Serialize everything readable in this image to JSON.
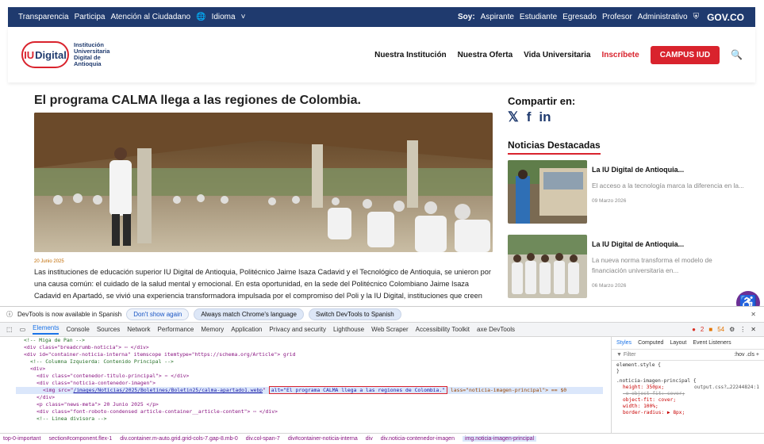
{
  "govbar": {
    "links": [
      "Transparencia",
      "Participa",
      "Atención al Ciudadano"
    ],
    "language": "Idioma",
    "soy_label": "Soy:",
    "roles": [
      "Aspirante",
      "Estudiante",
      "Egresado",
      "Profesor",
      "Administrativo"
    ],
    "gov_logo": "GOV.CO"
  },
  "header": {
    "logo_mark_iu": "IU",
    "logo_mark_rest": "Digital",
    "logo_lines": [
      "Institución",
      "Universitaria",
      "Digital de",
      "Antioquia"
    ],
    "nav": [
      "Nuestra Institución",
      "Nuestra Oferta",
      "Vida Universitaria"
    ],
    "inscribete": "Inscríbete",
    "campus": "CAMPUS IUD"
  },
  "article": {
    "title": "El programa CALMA llega a las regiones de Colombia.",
    "date": "20 Junio 2025",
    "body": "Las instituciones de educación superior IU Digital de Antioquia, Politécnico Jaime Isaza Cadavid y el Tecnológico de Antioquia, se unieron por una causa común: el cuidado de la salud mental y emocional. En esta oportunidad, en la sede del Politécnico Colombiano Jaime Isaza Cadavid en Apartadó, se vivió una experiencia transformadora impulsada por el compromiso del Poli y la IU Digital, instituciones que creen que la educación va"
  },
  "sidebar": {
    "share_title": "Compartir en:",
    "featured_title": "Noticias Destacadas",
    "news": [
      {
        "title": "La IU Digital de Antioquia...",
        "desc": "El acceso a la tecnología marca la diferencia en la...",
        "date": "09 Marzo 2026"
      },
      {
        "title": "La IU Digital de Antioquia...",
        "desc": "La nueva norma transforma el modelo de financiación universitaria en...",
        "date": "06 Marzo 2026"
      }
    ]
  },
  "devtools": {
    "notice": "DevTools is now available in Spanish",
    "btn_dont": "Don't show again",
    "btn_match": "Always match Chrome's language",
    "btn_switch": "Switch DevTools to Spanish",
    "tabs": [
      "Elements",
      "Console",
      "Sources",
      "Network",
      "Performance",
      "Memory",
      "Application",
      "Privacy and security",
      "Lighthouse",
      "Web Scraper",
      "Accessibility Toolkit",
      "axe DevTools"
    ],
    "errors": "2",
    "warnings": "54",
    "code": {
      "l1": "<!-- Miga de Pan -->",
      "l2": "<div class=\"breadcrumb-noticia\"> ⋯ </div>",
      "l3": "<div id=\"container-noticia-interna\" itemscope itemtype=\"https://schema.org/Article\"> grid",
      "l4": "<!-- Columna Izquierda: Contenido Principal -->",
      "l5": "<div>",
      "l6": "<div class=\"contenedor-titulo-principal\"> ⋯ </div>",
      "l7": "<div class=\"noticia-contenedor-imagen\">",
      "l8a": "<img src=\"",
      "l8src": "/images/Noticias/2025/Boletines/Boletin25/calma-apartado1.webp",
      "l8b": "\"",
      "l8alt": "alt=\"El programa CALMA llega a las regiones de Colombia.\"",
      "l8c": "lass=\"noticia-imagen-principal\"> == $0",
      "l9": "</div>",
      "l10": "<p class=\"news-meta\"> 20 Junio 2025 </p>",
      "l11": "<div class=\"font-roboto-condensed article-container__article-content\"> ⋯ </div>",
      "l12": "<!-- Linea divisora -->"
    },
    "styles_tabs": [
      "Styles",
      "Computed",
      "Layout",
      "Event Listeners"
    ],
    "filter": "Filter",
    "filter_right": ":hov .cls +",
    "element_style": "element.style {",
    "rule_selector": ".noticia-imagen-principal {",
    "rule_source": "output.css?…22244824:1",
    "rule_props": [
      "height: 350px;",
      "-o-object-fit: cover;",
      "object-fit: cover;",
      "width: 100%;",
      "border-radius: ▶ 8px;"
    ],
    "crumbs": [
      "top-0-important",
      "section#component.flex-1",
      "div.container.m-auto.grid.grid-cols-7.gap-8.mb-0",
      "div.col-span-7",
      "div#container-noticia-interna",
      "div",
      "div.noticia-contenedor-imagen",
      "img.noticia-imagen-principal"
    ]
  }
}
